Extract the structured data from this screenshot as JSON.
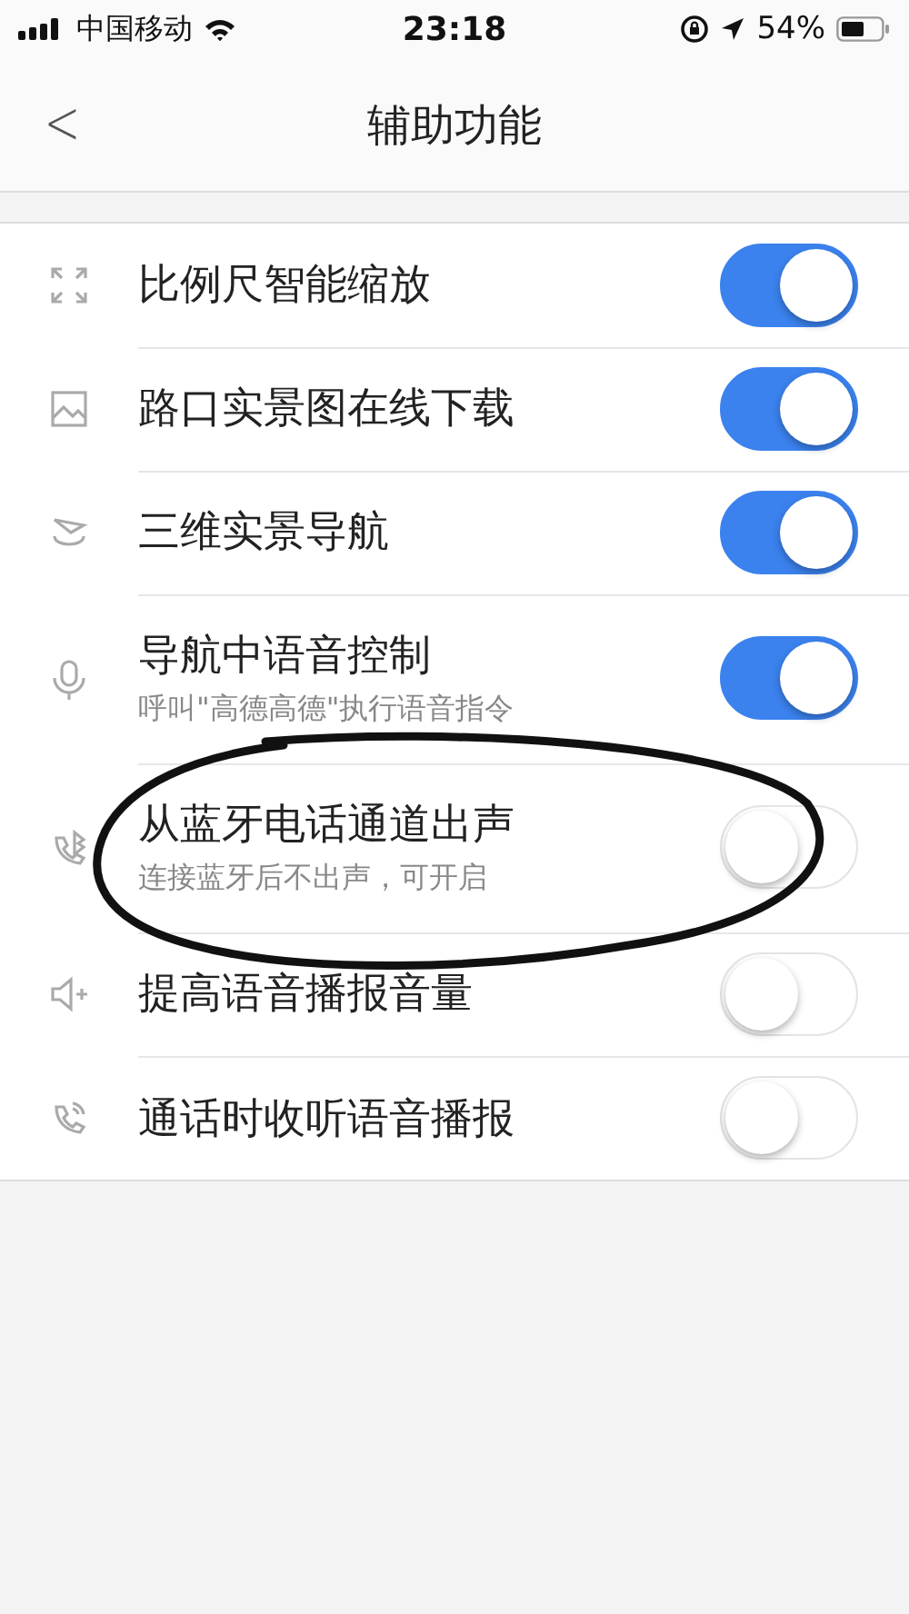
{
  "status_bar": {
    "carrier": "中国移动",
    "time": "23:18",
    "battery": "54%"
  },
  "nav_bar": {
    "back": "<",
    "title": "辅助功能"
  },
  "settings": [
    {
      "label": "比例尺智能缩放",
      "on": true
    },
    {
      "label": "路口实景图在线下载",
      "on": true
    },
    {
      "label": "三维实景导航",
      "on": true
    },
    {
      "label": "导航中语音控制",
      "subtitle": "呼叫\"高德高德\"执行语音指令",
      "on": true
    },
    {
      "label": "从蓝牙电话通道出声",
      "subtitle": "连接蓝牙后不出声，可开启",
      "on": false
    },
    {
      "label": "提高语音播报音量",
      "on": false
    },
    {
      "label": "通话时收听语音播报",
      "on": false
    }
  ]
}
